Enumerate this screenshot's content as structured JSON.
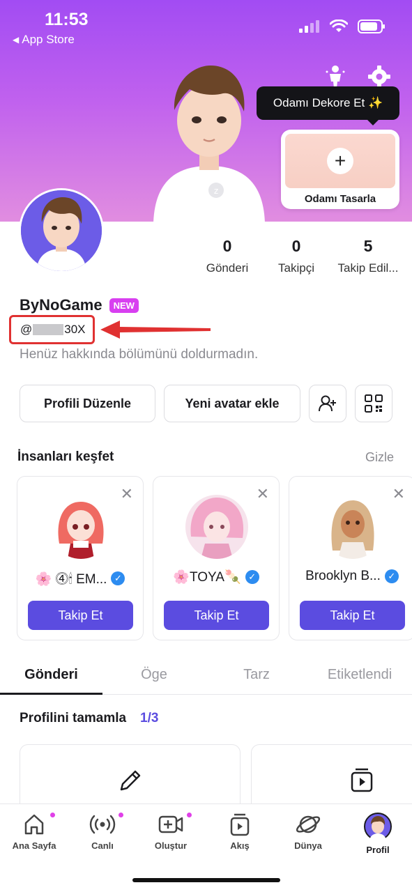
{
  "status_bar": {
    "time": "11:53",
    "back_label": "App Store"
  },
  "header": {
    "tooltip_text": "Odamı Dekore Et ✨",
    "room_card_label": "Odamı Tasarla"
  },
  "stats": [
    {
      "value": "0",
      "label": "Gönderi"
    },
    {
      "value": "0",
      "label": "Takipçi"
    },
    {
      "value": "5",
      "label": "Takip Edil..."
    }
  ],
  "profile": {
    "username": "ByNoGame",
    "badge": "NEW",
    "handle_prefix": "@",
    "handle_suffix": "30X",
    "bio": "Henüz hakkında bölümünü doldurmadın."
  },
  "actions": {
    "edit_profile": "Profili Düzenle",
    "new_avatar": "Yeni avatar ekle"
  },
  "discover": {
    "title": "İnsanları keşfet",
    "hide_label": "Gizle",
    "people": [
      {
        "name": "🌸 ⓸🕯 EM...",
        "follow_label": "Takip Et"
      },
      {
        "name": "🌸TOYA🍡",
        "follow_label": "Takip Et"
      },
      {
        "name": "Brooklyn B...",
        "follow_label": "Takip Et"
      }
    ]
  },
  "tabs": [
    "Gönderi",
    "Öge",
    "Tarz",
    "Etiketlendi"
  ],
  "complete_profile": {
    "title": "Profilini tamamla",
    "count": "1/3"
  },
  "bottom_nav": [
    {
      "label": "Ana Sayfa",
      "icon": "home-icon"
    },
    {
      "label": "Canlı",
      "icon": "live-icon"
    },
    {
      "label": "Oluştur",
      "icon": "create-icon"
    },
    {
      "label": "Akış",
      "icon": "feed-icon"
    },
    {
      "label": "Dünya",
      "icon": "world-icon"
    },
    {
      "label": "Profil",
      "icon": "profile-avatar-icon"
    }
  ],
  "colors": {
    "accent": "#5b4ce0",
    "badge": "#d83ff0",
    "annotation": "#e03131"
  }
}
